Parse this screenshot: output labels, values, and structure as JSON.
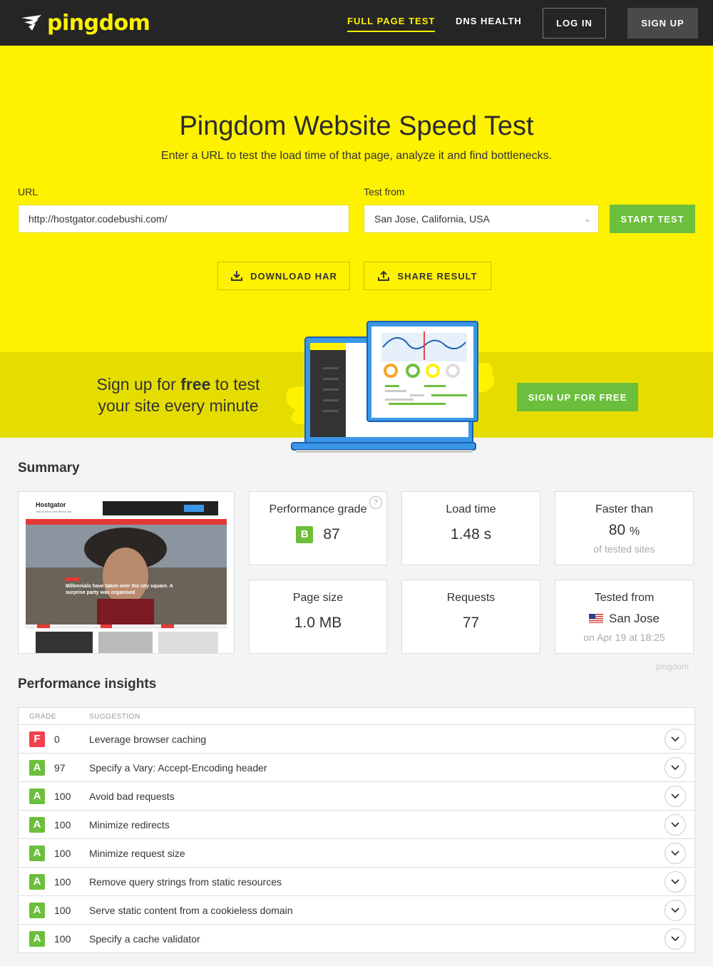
{
  "brand": {
    "name": "pingdom",
    "accent": "#fff200",
    "green": "#6cbf3c",
    "red": "#f0414c"
  },
  "nav": {
    "full_page_test": "FULL PAGE TEST",
    "dns_health": "DNS HEALTH",
    "log_in": "LOG IN",
    "sign_up": "SIGN UP"
  },
  "hero": {
    "title": "Pingdom Website Speed Test",
    "subtitle": "Enter a URL to test the load time of that page, analyze it and find bottlenecks.",
    "url_label": "URL",
    "url_value": "http://hostgator.codebushi.com/",
    "test_from_label": "Test from",
    "test_from_value": "San Jose, California, USA",
    "start_test": "START TEST",
    "download_har": "DOWNLOAD HAR",
    "share_result": "SHARE RESULT"
  },
  "promo": {
    "line1_pre": "Sign up for ",
    "line1_bold": "free",
    "line1_post": " to test",
    "line2": "your site every minute",
    "button": "SIGN UP FOR FREE"
  },
  "summary": {
    "heading": "Summary",
    "thumbnail": {
      "site_name": "Hostgator",
      "site_tagline": "Just another WordPress site",
      "headline": "Millennials have taken over the city square. A surprise party was organised"
    },
    "performance": {
      "label": "Performance grade",
      "grade": "B",
      "score": "87"
    },
    "load_time": {
      "label": "Load time",
      "value": "1.48 s"
    },
    "faster_than": {
      "label": "Faster than",
      "value": "80",
      "unit": "%",
      "sub": "of tested sites"
    },
    "page_size": {
      "label": "Page size",
      "value": "1.0 MB"
    },
    "requests": {
      "label": "Requests",
      "value": "77"
    },
    "tested_from": {
      "label": "Tested from",
      "value": "San Jose",
      "sub": "on Apr 19 at 18:25"
    },
    "watermark": "pingdom"
  },
  "insights": {
    "heading": "Performance insights",
    "col_grade": "GRADE",
    "col_suggestion": "SUGGESTION",
    "rows": [
      {
        "grade": "F",
        "score": "0",
        "suggestion": "Leverage browser caching"
      },
      {
        "grade": "A",
        "score": "97",
        "suggestion": "Specify a Vary: Accept-Encoding header"
      },
      {
        "grade": "A",
        "score": "100",
        "suggestion": "Avoid bad requests"
      },
      {
        "grade": "A",
        "score": "100",
        "suggestion": "Minimize redirects"
      },
      {
        "grade": "A",
        "score": "100",
        "suggestion": "Minimize request size"
      },
      {
        "grade": "A",
        "score": "100",
        "suggestion": "Remove query strings from static resources"
      },
      {
        "grade": "A",
        "score": "100",
        "suggestion": "Serve static content from a cookieless domain"
      },
      {
        "grade": "A",
        "score": "100",
        "suggestion": "Specify a cache validator"
      }
    ]
  }
}
